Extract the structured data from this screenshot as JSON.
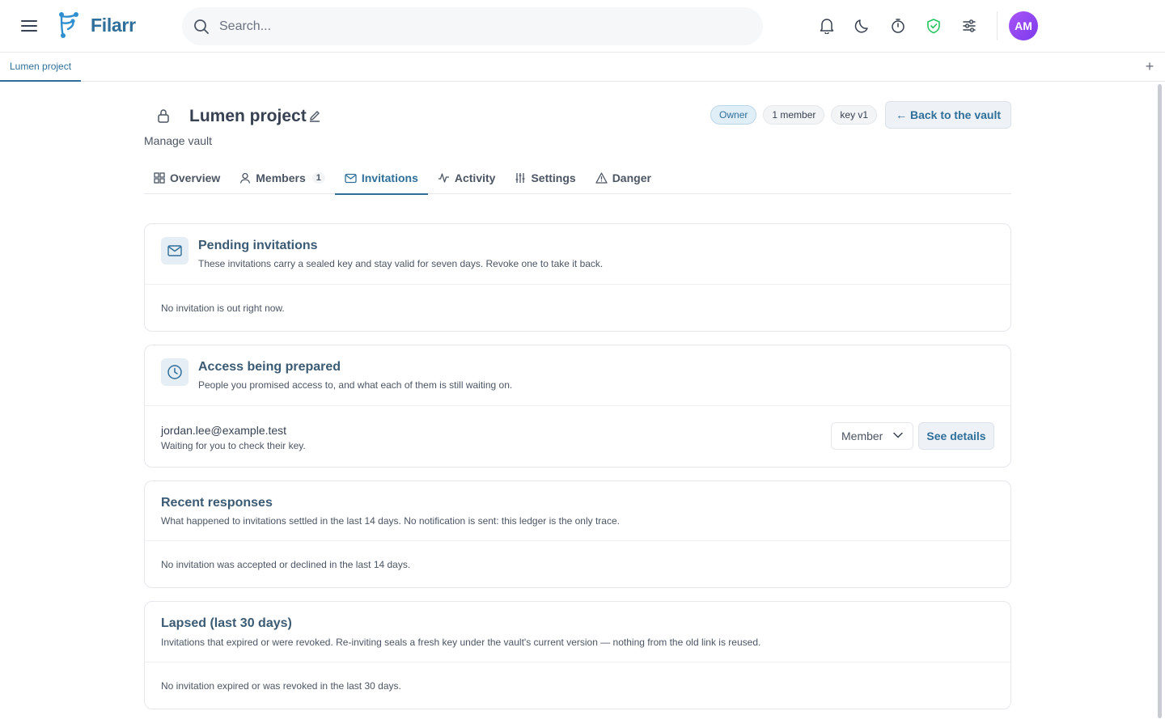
{
  "app": {
    "name": "Filarr",
    "search_placeholder": "Search...",
    "user_initials": "AM"
  },
  "tabstrip": {
    "tabs": [
      {
        "label": "Lumen project"
      }
    ],
    "add_label": "+"
  },
  "vault": {
    "title": "Lumen project",
    "subtitle": "Manage vault",
    "badges": {
      "role": "Owner",
      "members": "1 member",
      "key": "key v1"
    },
    "back_label": "← Back to the vault"
  },
  "tabs": [
    {
      "label": "Overview",
      "icon": "grid-icon"
    },
    {
      "label": "Members",
      "icon": "user-icon",
      "count": "1"
    },
    {
      "label": "Invitations",
      "icon": "mail-icon",
      "active": true
    },
    {
      "label": "Activity",
      "icon": "activity-icon"
    },
    {
      "label": "Settings",
      "icon": "sliders-icon"
    },
    {
      "label": "Danger",
      "icon": "warning-icon"
    }
  ],
  "pending": {
    "title": "Pending invitations",
    "description": "These invitations carry a sealed key and stay valid for seven days. Revoke one to take it back.",
    "empty": "No invitation is out right now."
  },
  "preparing": {
    "title": "Access being prepared",
    "description": "People you promised access to, and what each of them is still waiting on.",
    "rows": [
      {
        "email": "jordan.lee@example.test",
        "status": "Waiting for you to check their key.",
        "role": "Member",
        "action": "See details"
      }
    ]
  },
  "recent": {
    "title": "Recent responses",
    "description": "What happened to invitations settled in the last 14 days. No notification is sent: this ledger is the only trace.",
    "empty": "No invitation was accepted or declined in the last 14 days."
  },
  "lapsed": {
    "title": "Lapsed (last 30 days)",
    "description": "Invitations that expired or were revoked. Re-inviting seals a fresh key under the vault's current version — nothing from the old link is reused.",
    "empty": "No invitation expired or was revoked in the last 30 days."
  },
  "colors": {
    "accent": "#2f6f99",
    "shield": "#22c55e",
    "avatar": "#9333ea"
  }
}
